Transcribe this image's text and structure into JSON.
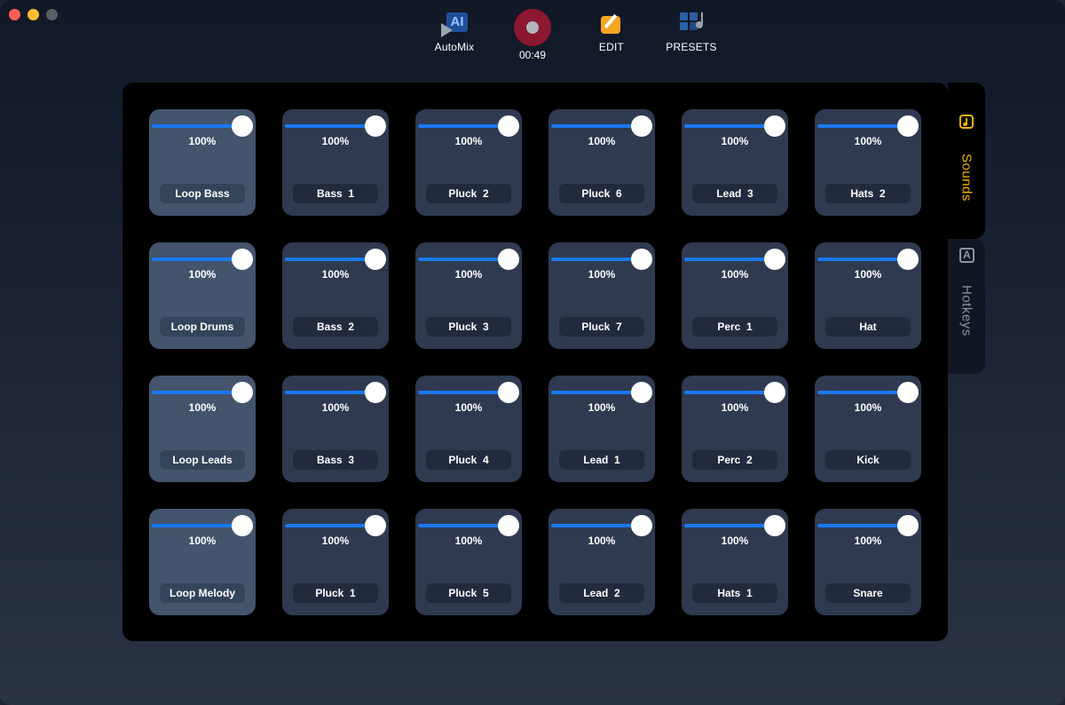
{
  "toolbar": {
    "automix": {
      "label": "AutoMix",
      "icon": "automix-ai-icon",
      "badge": "AI"
    },
    "record": {
      "time": "00:49",
      "icon": "record-icon",
      "color": "#8b1730"
    },
    "edit": {
      "label": "EDIT",
      "icon": "edit-icon"
    },
    "presets": {
      "label": "PRESETS",
      "icon": "presets-icon"
    }
  },
  "tabs": {
    "sounds": {
      "label": "Sounds",
      "icon": "music-note-icon",
      "active": true,
      "color": "#f5b400"
    },
    "hotkeys": {
      "label": "Hotkeys",
      "icon": "hotkey-a-icon",
      "icon_text": "A",
      "active": false
    }
  },
  "colors": {
    "slider": "#1a78f0",
    "pad": "#2f3a51",
    "loop_pad": "#43546c"
  },
  "pads": [
    {
      "name": "Loop Bass",
      "volume": "100%",
      "level": 1.0,
      "type": "loop"
    },
    {
      "name": "Bass  1",
      "volume": "100%",
      "level": 1.0,
      "type": "sound"
    },
    {
      "name": "Pluck  2",
      "volume": "100%",
      "level": 1.0,
      "type": "sound"
    },
    {
      "name": "Pluck  6",
      "volume": "100%",
      "level": 1.0,
      "type": "sound"
    },
    {
      "name": "Lead  3",
      "volume": "100%",
      "level": 1.0,
      "type": "sound"
    },
    {
      "name": "Hats  2",
      "volume": "100%",
      "level": 1.0,
      "type": "sound"
    },
    {
      "name": "Loop Drums",
      "volume": "100%",
      "level": 1.0,
      "type": "loop"
    },
    {
      "name": "Bass  2",
      "volume": "100%",
      "level": 1.0,
      "type": "sound"
    },
    {
      "name": "Pluck  3",
      "volume": "100%",
      "level": 1.0,
      "type": "sound"
    },
    {
      "name": "Pluck  7",
      "volume": "100%",
      "level": 1.0,
      "type": "sound"
    },
    {
      "name": "Perc  1",
      "volume": "100%",
      "level": 1.0,
      "type": "sound"
    },
    {
      "name": "Hat",
      "volume": "100%",
      "level": 1.0,
      "type": "sound"
    },
    {
      "name": "Loop Leads",
      "volume": "100%",
      "level": 1.0,
      "type": "loop"
    },
    {
      "name": "Bass  3",
      "volume": "100%",
      "level": 1.0,
      "type": "sound"
    },
    {
      "name": "Pluck  4",
      "volume": "100%",
      "level": 1.0,
      "type": "sound"
    },
    {
      "name": "Lead  1",
      "volume": "100%",
      "level": 1.0,
      "type": "sound"
    },
    {
      "name": "Perc  2",
      "volume": "100%",
      "level": 1.0,
      "type": "sound"
    },
    {
      "name": "Kick",
      "volume": "100%",
      "level": 1.0,
      "type": "sound"
    },
    {
      "name": "Loop Melody",
      "volume": "100%",
      "level": 1.0,
      "type": "loop"
    },
    {
      "name": "Pluck  1",
      "volume": "100%",
      "level": 1.0,
      "type": "sound"
    },
    {
      "name": "Pluck  5",
      "volume": "100%",
      "level": 1.0,
      "type": "sound"
    },
    {
      "name": "Lead  2",
      "volume": "100%",
      "level": 1.0,
      "type": "sound"
    },
    {
      "name": "Hats  1",
      "volume": "100%",
      "level": 1.0,
      "type": "sound"
    },
    {
      "name": "Snare",
      "volume": "100%",
      "level": 1.0,
      "type": "sound"
    }
  ]
}
